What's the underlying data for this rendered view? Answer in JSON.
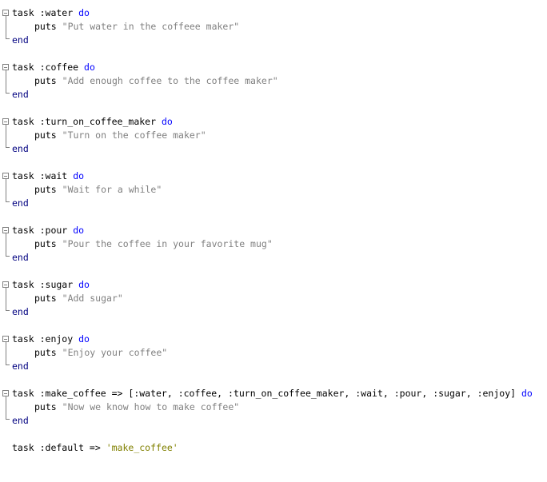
{
  "blocks": [
    {
      "task": "task :water",
      "do": "do",
      "puts": "puts",
      "str": "\"Put water in the coffeee maker\"",
      "end": "end"
    },
    {
      "task": "task :coffee",
      "do": "do",
      "puts": "puts",
      "str": "\"Add enough coffee to the coffee maker\"",
      "end": "end"
    },
    {
      "task": "task :turn_on_coffee_maker",
      "do": "do",
      "puts": "puts",
      "str": "\"Turn on the coffee maker\"",
      "end": "end"
    },
    {
      "task": "task :wait",
      "do": "do",
      "puts": "puts",
      "str": "\"Wait for a while\"",
      "end": "end"
    },
    {
      "task": "task :pour",
      "do": "do",
      "puts": "puts",
      "str": "\"Pour the coffee in your favorite mug\"",
      "end": "end"
    },
    {
      "task": "task :sugar",
      "do": "do",
      "puts": "puts",
      "str": "\"Add sugar\"",
      "end": "end"
    },
    {
      "task": "task :enjoy",
      "do": "do",
      "puts": "puts",
      "str": "\"Enjoy your coffee\"",
      "end": "end"
    },
    {
      "task": "task :make_coffee => [:water, :coffee, :turn_on_coffee_maker, :wait, :pour, :sugar, :enjoy]",
      "do": "do",
      "puts": "puts",
      "str": "\"Now we know how to make coffee\"",
      "end": "end"
    }
  ],
  "default_line": {
    "code": "task :default => ",
    "value": "'make_coffee'"
  }
}
